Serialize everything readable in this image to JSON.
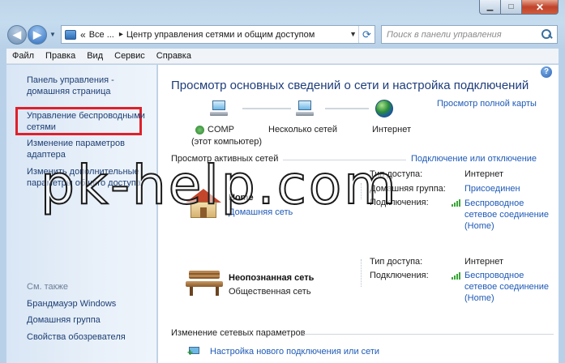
{
  "window": {
    "caption_buttons": {
      "minimize": "▁",
      "maximize": "□",
      "close": "✕"
    }
  },
  "address_bar": {
    "segments": [
      "Все ...",
      "Центр управления сетями и общим доступом"
    ],
    "chevron": "«",
    "separator": "▸"
  },
  "search": {
    "placeholder": "Поиск в панели управления"
  },
  "menu": [
    {
      "label": "Файл"
    },
    {
      "label": "Правка"
    },
    {
      "label": "Вид"
    },
    {
      "label": "Сервис"
    },
    {
      "label": "Справка"
    }
  ],
  "sidebar": {
    "home": "Панель управления - домашняя страница",
    "wireless": "Управление беспроводными сетями",
    "adapter": "Изменение параметров адаптера",
    "sharing": "Изменить дополнительные параметры общего доступа",
    "see_also": "См. также",
    "firewall": "Брандмауэр Windows",
    "homegroup": "Домашняя группа",
    "browser": "Свойства обозревателя"
  },
  "main": {
    "help": "?",
    "title": "Просмотр основных сведений о сети и настройка подключений",
    "full_map": "Просмотр полной карты",
    "map": {
      "computer_name": "COMP",
      "computer_note": "(этот компьютер)",
      "middle": "Несколько сетей",
      "internet": "Интернет"
    },
    "active_header": "Просмотр активных сетей",
    "connect_link": "Подключение или отключение",
    "networks": [
      {
        "name": "Home",
        "type": "Домашняя сеть",
        "access_label": "Тип доступа:",
        "access_value": "Интернет",
        "homegroup_label": "Домашняя группа:",
        "homegroup_value": "Присоединен",
        "conn_label": "Подключения:",
        "conn_value": "Беспроводное сетевое соединение (Home)"
      },
      {
        "name": "Неопознанная сеть",
        "type": "Общественная сеть",
        "access_label": "Тип доступа:",
        "access_value": "Интернет",
        "conn_label": "Подключения:",
        "conn_value": "Беспроводное сетевое соединение (Home)"
      }
    ],
    "change_header": "Изменение сетевых параметров",
    "new_connection": "Настройка нового подключения или сети"
  },
  "watermark": "pk-help.com"
}
